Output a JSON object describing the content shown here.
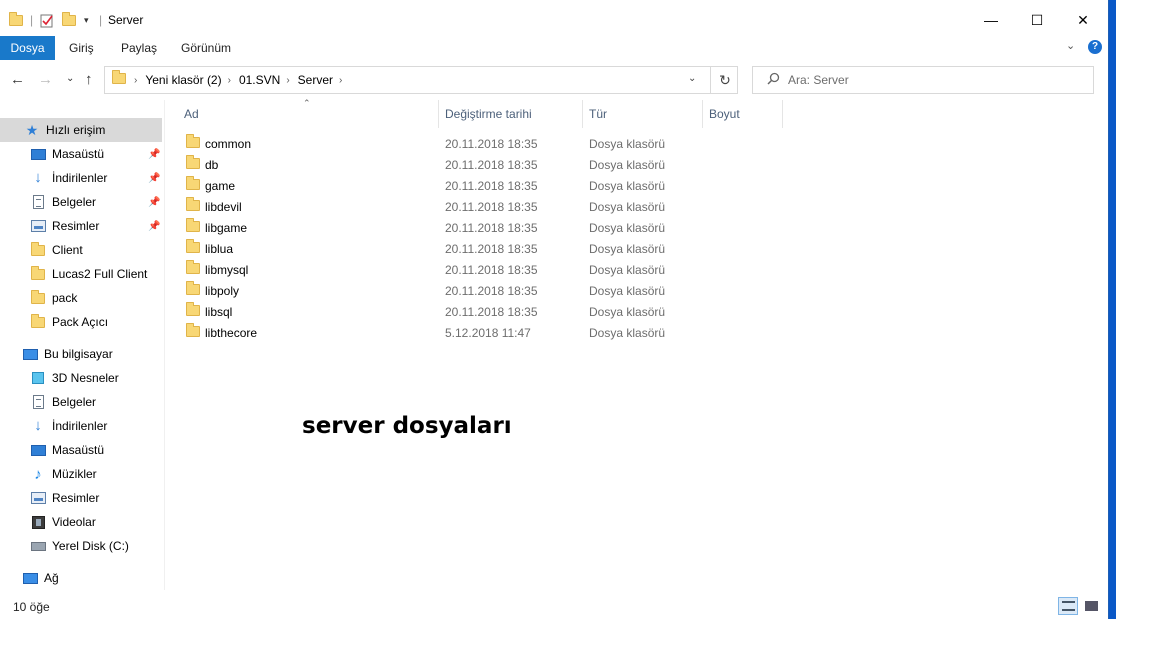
{
  "window": {
    "title": "Server",
    "controls": {
      "minimize": "—",
      "maximize": "☐",
      "close": "✕"
    }
  },
  "ribbon": {
    "tabs": [
      {
        "label": "Dosya",
        "active": true
      },
      {
        "label": "Giriş"
      },
      {
        "label": "Paylaş"
      },
      {
        "label": "Görünüm"
      }
    ],
    "help": "?",
    "collapse": "⌄"
  },
  "address": {
    "crumbs": [
      "Yeni klasör (2)",
      "01.SVN",
      "Server"
    ],
    "refresh": "↻",
    "dropdown": "⌄"
  },
  "search": {
    "placeholder": "Ara: Server"
  },
  "nav": {
    "back": "←",
    "forward": "→",
    "recent": "⌄",
    "up": "↑"
  },
  "sidebar": {
    "quick_access": "Hızlı erişim",
    "quick_items": [
      {
        "label": "Masaüstü",
        "icon": "desktop-icon",
        "pinned": true
      },
      {
        "label": "İndirilenler",
        "icon": "downloads-icon",
        "pinned": true
      },
      {
        "label": "Belgeler",
        "icon": "documents-icon",
        "pinned": true
      },
      {
        "label": "Resimler",
        "icon": "pictures-icon",
        "pinned": true
      },
      {
        "label": "Client",
        "icon": "folder-icon"
      },
      {
        "label": "Lucas2 Full Client",
        "icon": "folder-icon"
      },
      {
        "label": "pack",
        "icon": "folder-icon"
      },
      {
        "label": "Pack Açıcı",
        "icon": "folder-icon"
      }
    ],
    "this_pc": "Bu bilgisayar",
    "pc_items": [
      {
        "label": "3D Nesneler",
        "icon": "3d-objects-icon"
      },
      {
        "label": "Belgeler",
        "icon": "documents-icon"
      },
      {
        "label": "İndirilenler",
        "icon": "downloads-icon"
      },
      {
        "label": "Masaüstü",
        "icon": "desktop-icon"
      },
      {
        "label": "Müzikler",
        "icon": "music-icon"
      },
      {
        "label": "Resimler",
        "icon": "pictures-icon"
      },
      {
        "label": "Videolar",
        "icon": "videos-icon"
      },
      {
        "label": "Yerel Disk (C:)",
        "icon": "local-disk-icon"
      }
    ],
    "network": "Ağ"
  },
  "columns": {
    "name": "Ad",
    "date": "Değiştirme tarihi",
    "type": "Tür",
    "size": "Boyut"
  },
  "files": [
    {
      "name": "common",
      "date": "20.11.2018 18:35",
      "type": "Dosya klasörü"
    },
    {
      "name": "db",
      "date": "20.11.2018 18:35",
      "type": "Dosya klasörü"
    },
    {
      "name": "game",
      "date": "20.11.2018 18:35",
      "type": "Dosya klasörü"
    },
    {
      "name": "libdevil",
      "date": "20.11.2018 18:35",
      "type": "Dosya klasörü"
    },
    {
      "name": "libgame",
      "date": "20.11.2018 18:35",
      "type": "Dosya klasörü"
    },
    {
      "name": "liblua",
      "date": "20.11.2018 18:35",
      "type": "Dosya klasörü"
    },
    {
      "name": "libmysql",
      "date": "20.11.2018 18:35",
      "type": "Dosya klasörü"
    },
    {
      "name": "libpoly",
      "date": "20.11.2018 18:35",
      "type": "Dosya klasörü"
    },
    {
      "name": "libsql",
      "date": "20.11.2018 18:35",
      "type": "Dosya klasörü"
    },
    {
      "name": "libthecore",
      "date": "5.12.2018 11:47",
      "type": "Dosya klasörü"
    }
  ],
  "annotation": "server dosyaları",
  "status": {
    "count": "10 öğe"
  },
  "colors": {
    "accent": "#1979ca",
    "selection": "#d9d9d9",
    "folder": "#f8d775"
  }
}
